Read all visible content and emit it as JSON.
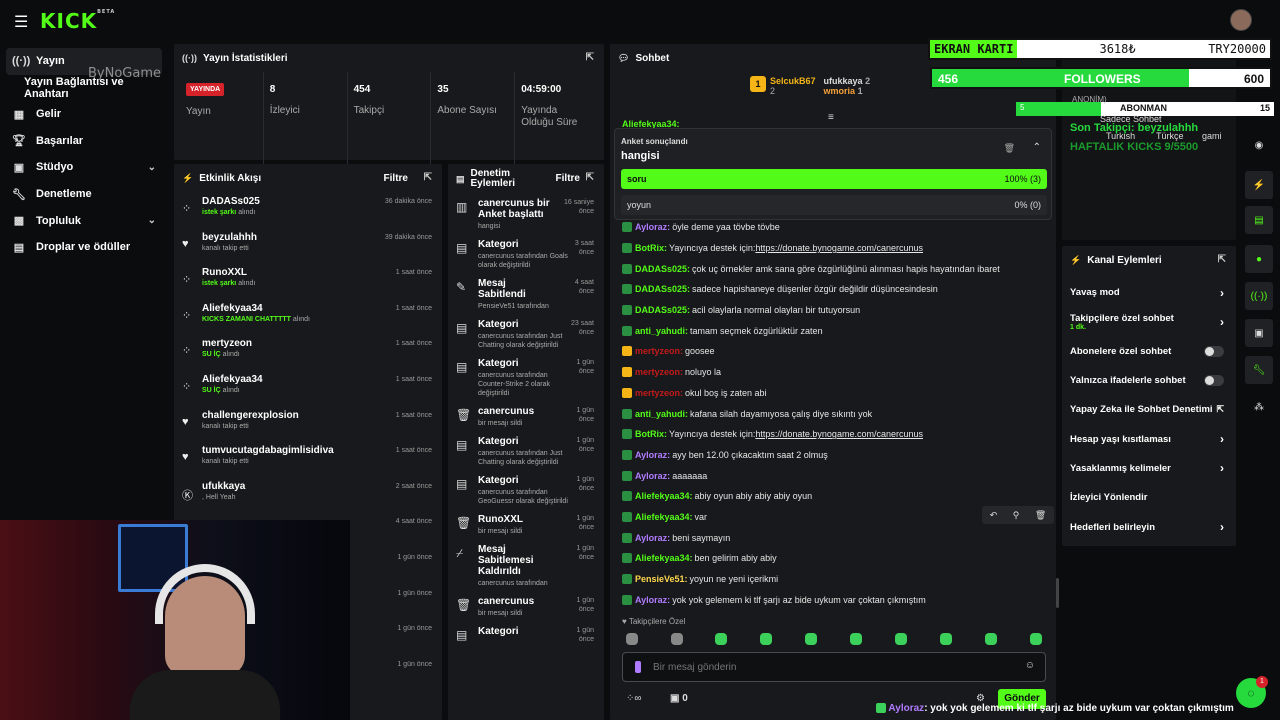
{
  "brand": {
    "logo": "KICK",
    "beta": "BETA"
  },
  "sidebar": {
    "items": [
      {
        "label": "Yayın",
        "icon": "broadcast-icon"
      },
      {
        "label": "Gelir",
        "icon": "chart-icon"
      },
      {
        "label": "Başarılar",
        "icon": "trophy-icon"
      },
      {
        "label": "Stüdyo",
        "icon": "studio-icon"
      },
      {
        "label": "Denetleme",
        "icon": "wrench-icon"
      },
      {
        "label": "Topluluk",
        "icon": "community-icon"
      },
      {
        "label": "Droplar ve ödüller",
        "icon": "drops-icon"
      }
    ],
    "sub_item": "Yayın Bağlantısı ve Anahtarı"
  },
  "stats": {
    "title": "Yayın İstatistikleri",
    "live_badge": "YAYINDA",
    "items": [
      {
        "value": "8",
        "label": "İzleyici"
      },
      {
        "value": "454",
        "label": "Takipçi"
      },
      {
        "value": "35",
        "label": "Abone Sayısı"
      },
      {
        "value": "04:59:00",
        "label": "Yayında Olduğu Süre"
      }
    ],
    "live_label": "Yayın"
  },
  "activity": {
    "title": "Etkinlik Akışı",
    "filter": "Filtre",
    "rows": [
      {
        "name": "DADASs025",
        "sub": "istek şarkı",
        "suffix": "alındı",
        "time": "36 dakika önce",
        "icon": "gift-icon"
      },
      {
        "name": "beyzulahhh",
        "sub": "kanalı takip etti",
        "suffix": "",
        "time": "39 dakika önce",
        "icon": "heart-icon"
      },
      {
        "name": "RunoXXL",
        "sub": "istek şarkı",
        "suffix": "alındı",
        "time": "1 saat önce",
        "icon": "gift-icon"
      },
      {
        "name": "Aliefekyaa34",
        "sub": "KICKS ZAMANI CHATTTTT",
        "suffix": "alındı",
        "time": "1 saat önce",
        "icon": "gift-icon"
      },
      {
        "name": "mertyzeon",
        "sub": "SU İÇ",
        "suffix": "alındı",
        "time": "1 saat önce",
        "icon": "gift-icon"
      },
      {
        "name": "Aliefekyaa34",
        "sub": "SU İÇ",
        "suffix": "alındı",
        "time": "1 saat önce",
        "icon": "gift-icon"
      },
      {
        "name": "challengerexplosion",
        "sub": "kanalı takip etti",
        "suffix": "",
        "time": "1 saat önce",
        "icon": "heart-icon"
      },
      {
        "name": "tumvucutagdabagimlisidiva",
        "sub": "kanalı takip etti",
        "suffix": "",
        "time": "1 saat önce",
        "icon": "heart-icon"
      },
      {
        "name": "ufukkaya",
        "sub": ", Hell Yeah",
        "suffix": "",
        "time": "2 saat önce",
        "icon": "kick-icon"
      },
      {
        "name": "",
        "sub": "",
        "suffix": "",
        "time": "4 saat önce",
        "icon": ""
      },
      {
        "name": "",
        "sub": "",
        "suffix": "",
        "time": "1 gün önce",
        "icon": ""
      },
      {
        "name": "",
        "sub": "",
        "suffix": "",
        "time": "1 gün önce",
        "icon": ""
      },
      {
        "name": "",
        "sub": "",
        "suffix": "",
        "time": "1 gün önce",
        "icon": ""
      },
      {
        "name": "",
        "sub": "",
        "suffix": "",
        "time": "1 gün önce",
        "icon": ""
      }
    ],
    "kick_count": "1"
  },
  "moderation": {
    "title": "Denetim Eylemleri",
    "filter": "Filtre",
    "rows": [
      {
        "title": "canercunus bir Anket başlattı",
        "sub": "hangisi",
        "time": "16 saniye önce",
        "icon": "poll-icon"
      },
      {
        "title": "Kategori",
        "sub": "canercunus tarafından Goals olarak değiştirildi",
        "time": "3 saat önce",
        "icon": "category-icon"
      },
      {
        "title": "Mesaj Sabitlendi",
        "sub": "PensieVe51 tarafından",
        "time": "4 saat önce",
        "icon": "pin-icon"
      },
      {
        "title": "Kategori",
        "sub": "canercunus tarafından Just Chatting olarak değiştirildi",
        "time": "23 saat önce",
        "icon": "category-icon"
      },
      {
        "title": "Kategori",
        "sub": "canercunus tarafından Counter-Strike 2 olarak değiştirildi",
        "time": "1 gün önce",
        "icon": "category-icon"
      },
      {
        "title": "canercunus",
        "sub": "bir mesajı sildi",
        "time": "1 gün önce",
        "icon": "trash-icon"
      },
      {
        "title": "Kategori",
        "sub": "canercunus tarafından Just Chatting olarak değiştirildi",
        "time": "1 gün önce",
        "icon": "category-icon"
      },
      {
        "title": "Kategori",
        "sub": "canercunus tarafından GeoGuessr olarak değiştirildi",
        "time": "1 gün önce",
        "icon": "category-icon"
      },
      {
        "title": "RunoXXL",
        "sub": "bir mesajı sildi",
        "time": "1 gün önce",
        "icon": "trash-icon"
      },
      {
        "title": "Mesaj Sabitlemesi Kaldırıldı",
        "sub": "canercunus tarafından",
        "time": "1 gün önce",
        "icon": "unpin-icon"
      },
      {
        "title": "canercunus",
        "sub": "bir mesajı sildi",
        "time": "1 gün önce",
        "icon": "trash-icon"
      },
      {
        "title": "Kategori",
        "sub": "",
        "time": "1 gün önce",
        "icon": "category-icon"
      }
    ]
  },
  "chat": {
    "title": "Sohbet",
    "top": [
      {
        "name": "SelcukB67",
        "count": "2"
      },
      {
        "name": "ufukkaya",
        "count": "2"
      },
      {
        "name": "wmoria",
        "count": "1"
      }
    ],
    "pinned_user": "Aliefekyaa34:",
    "poll": {
      "header": "Anket sonuçlandı",
      "question": "hangisi",
      "options": [
        {
          "label": "soru",
          "result": "100% (3)"
        },
        {
          "label": "yoyun",
          "result": "0% (0)"
        }
      ]
    },
    "messages": [
      {
        "user": "Ayloraz:",
        "text": "öyle deme yaa tövbe tövbe",
        "color": "#b07cff"
      },
      {
        "user": "BotRix:",
        "text": "Yayıncıya destek için: ",
        "link": "https://donate.bynogame.com/canercunus",
        "color": "#53fc18"
      },
      {
        "user": "DADASs025:",
        "text": "çok uç örnekler amk sana göre özgürlüğünü alınması hapis hayatından ibaret",
        "color": "#53fc18"
      },
      {
        "user": "DADASs025:",
        "text": "sadece hapishaneye düşenler özgür değildir düşüncesindesin",
        "color": "#53fc18"
      },
      {
        "user": "DADASs025:",
        "text": "acil olaylarla normal olayları bir tutuyorsun",
        "color": "#53fc18"
      },
      {
        "user": "anti_yahudi:",
        "text": "tamam seçmek özgürlüktür zaten",
        "color": "#53fc18"
      },
      {
        "user": "mertyzeon:",
        "text": "goosee",
        "color": "#c41a1a"
      },
      {
        "user": "mertyzeon:",
        "text": "noluyo la",
        "color": "#c41a1a"
      },
      {
        "user": "mertyzeon:",
        "text": "okul boş iş zaten abi",
        "color": "#c41a1a"
      },
      {
        "user": "anti_yahudi:",
        "text": "kafana silah dayamıyosa çalış diye sıkıntı yok",
        "color": "#53fc18"
      },
      {
        "user": "BotRix:",
        "text": "Yayıncıya destek için: ",
        "link": "https://donate.bynogame.com/canercunus",
        "color": "#53fc18"
      },
      {
        "user": "Ayloraz:",
        "text": "ayy ben 12.00 çıkacaktım saat 2 olmuş",
        "color": "#b07cff"
      },
      {
        "user": "Ayloraz:",
        "text": "aaaaaaa",
        "color": "#b07cff"
      },
      {
        "user": "Aliefekyaa34:",
        "text": "abiy oyun abiy abiy abiy oyun",
        "color": "#53fc18"
      },
      {
        "user": "Aliefekyaa34:",
        "text": "var",
        "color": "#53fc18"
      },
      {
        "user": "Ayloraz:",
        "text": "beni saymayın",
        "color": "#b07cff"
      },
      {
        "user": "Aliefekyaa34:",
        "text": "ben gelirim abiy abiy",
        "color": "#53fc18"
      },
      {
        "user": "PensieVe51:",
        "text": "yoyun ne yeni içerikmi",
        "color": "#ffd84d"
      },
      {
        "user": "Ayloraz:",
        "text": "yok yok gelemem ki tlf şarjı az bide uykum var çoktan çıkmıştım",
        "color": "#b07cff"
      }
    ],
    "followers_only": "Takipçilere Özel",
    "input_placeholder": "Bir mesaj gönderin",
    "points": "0",
    "send_label": "Gönder"
  },
  "overlay": {
    "gpu_label": "EKRAN KARTI",
    "gpu_value": "3618₺",
    "gpu_target": "TRY20000",
    "followers_value": "456",
    "followers_label": "FOLLOWERS",
    "followers_target": "600",
    "followers_progress": 0.76,
    "subs_value": "5",
    "subs_label": "ABONMAN",
    "subs_target": "15",
    "subs_progress": 0.33,
    "last_follower": "Son Takipçi: beyzulahhh",
    "weekly_kicks": "HAFTALIK KICKS 9/5500",
    "bynogame": "ByNoGame",
    "bottom_ticker_user": "Ayloraz",
    "bottom_ticker_text": ": yok yok gelemem ki tlf şarjı az bide uykum var çoktan çıkmıştım",
    "behind_texts": [
      "ANONİM)",
      "Sadece Sohbet",
      "Turkish",
      "Türkçe",
      "gami"
    ]
  },
  "channel_actions": {
    "title": "Kanal Eylemleri",
    "rows": [
      {
        "label": "Yavaş mod",
        "ctrl": "arrow"
      },
      {
        "label": "Takipçilere özel sohbet",
        "ctrl": "arrow",
        "sub": "1 dk."
      },
      {
        "label": "Abonelere özel sohbet",
        "ctrl": "toggle"
      },
      {
        "label": "Yalnızca ifadelerle sohbet",
        "ctrl": "toggle"
      },
      {
        "label": "Yapay Zeka ile Sohbet Denetimi",
        "ctrl": "external"
      },
      {
        "label": "Hesap yaşı kısıtlaması",
        "ctrl": "arrow"
      },
      {
        "label": "Yasaklanmış kelimeler",
        "ctrl": "arrow"
      },
      {
        "label": "İzleyici Yönlendir",
        "ctrl": "none"
      },
      {
        "label": "Hedefleri belirleyin",
        "ctrl": "arrow"
      }
    ]
  },
  "notif_count": "1",
  "colors": {
    "brand": "#53fc18",
    "live": "#d6232a",
    "panel": "#18191c"
  }
}
